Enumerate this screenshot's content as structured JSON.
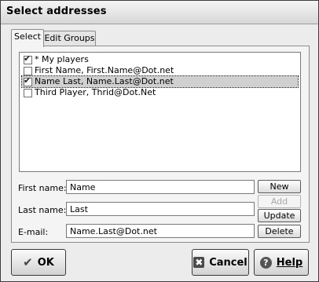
{
  "window": {
    "title": "Select addresses"
  },
  "tabs": [
    {
      "label": "Select",
      "active": true
    },
    {
      "label": "Edit Groups",
      "active": false
    }
  ],
  "list": {
    "items": [
      {
        "label": "* My players",
        "checked": true,
        "selected": false
      },
      {
        "label": "First Name, First.Name@Dot.net",
        "checked": false,
        "selected": false
      },
      {
        "label": "Name Last, Name.Last@Dot.net",
        "checked": true,
        "selected": true
      },
      {
        "label": "Third Player, Thrid@Dot.Net",
        "checked": false,
        "selected": false
      }
    ]
  },
  "form": {
    "first_name_label": "First name:",
    "first_name_value": "Name",
    "last_name_label": "Last name:",
    "last_name_value": "Last",
    "email_label": "E-mail:",
    "email_value": "Name.Last@Dot.net"
  },
  "buttons": {
    "new": "New",
    "add": "Add",
    "update": "Update",
    "delete": "Delete",
    "ok": "OK",
    "cancel": "Cancel",
    "help": "Help"
  },
  "icons": {
    "check": "✔",
    "ok": "✔",
    "cancel": "✖",
    "help": "?"
  }
}
